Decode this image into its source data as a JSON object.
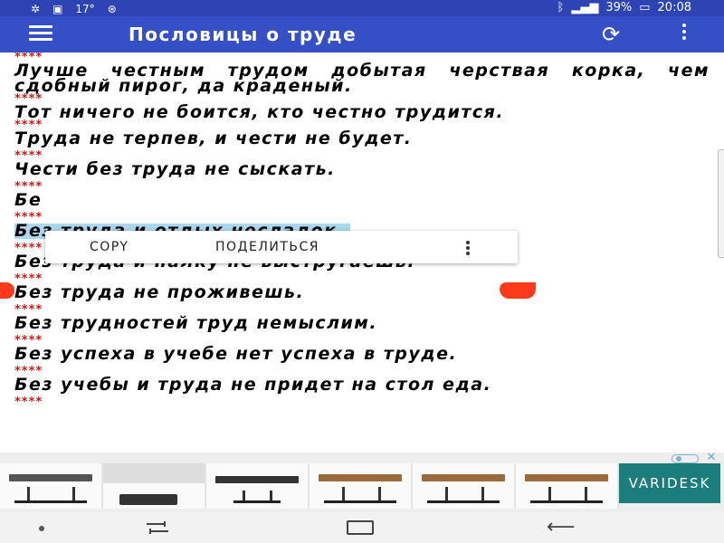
{
  "status_bar": {
    "left_icons": [
      "settings-icon",
      "image-icon",
      "notification-icon",
      "shield-icon"
    ],
    "left_text": "17°",
    "battery": "39%",
    "time": "20:08"
  },
  "app_bar": {
    "title": "Пословицы о труде",
    "menu_icon": "hamburger-menu-icon",
    "refresh_icon": "refresh-icon",
    "more_icon": "more-vert-icon"
  },
  "separator": "****",
  "proverbs": [
    {
      "text": "Лучше честным трудом добытая черствая корка, чем сдобный пирог, да краденый."
    },
    {
      "text": "Тот ничего не боится, кто честно трудится."
    },
    {
      "text": "Труда не терпев, и чести не будет."
    },
    {
      "text": "Чести без труда не сыскать."
    },
    {
      "text": "Бе"
    },
    {
      "text": "Без труда и отдых несладок."
    },
    {
      "text": "Без труда и палку не выстругаешь."
    },
    {
      "text": "Без труда не проживешь."
    },
    {
      "text": "Без трудностей труд немыслим."
    },
    {
      "text": "Без успеха в учебе нет успеха в труде."
    },
    {
      "text": "Без учебы и труда не придет на стол еда."
    }
  ],
  "selected_index": 5,
  "context_menu": {
    "copy": "COPY",
    "share": "ПОДЕЛИТЬСЯ",
    "more_icon": "more-vert-icon"
  },
  "ad": {
    "brand": "VARIDESK",
    "choices_icon": "adchoices-icon",
    "close_icon": "close-icon"
  },
  "nav_bar": {
    "icons": [
      "nav-dot-icon",
      "recent-apps-icon",
      "home-icon",
      "back-icon"
    ]
  },
  "colors": {
    "status_bar": "#2f44b4",
    "app_bar": "#3550c6",
    "separator": "#d01818",
    "selection": "#aad7ee",
    "handle": "#fd3a1a",
    "ad_brand": "#1c7d7d"
  }
}
